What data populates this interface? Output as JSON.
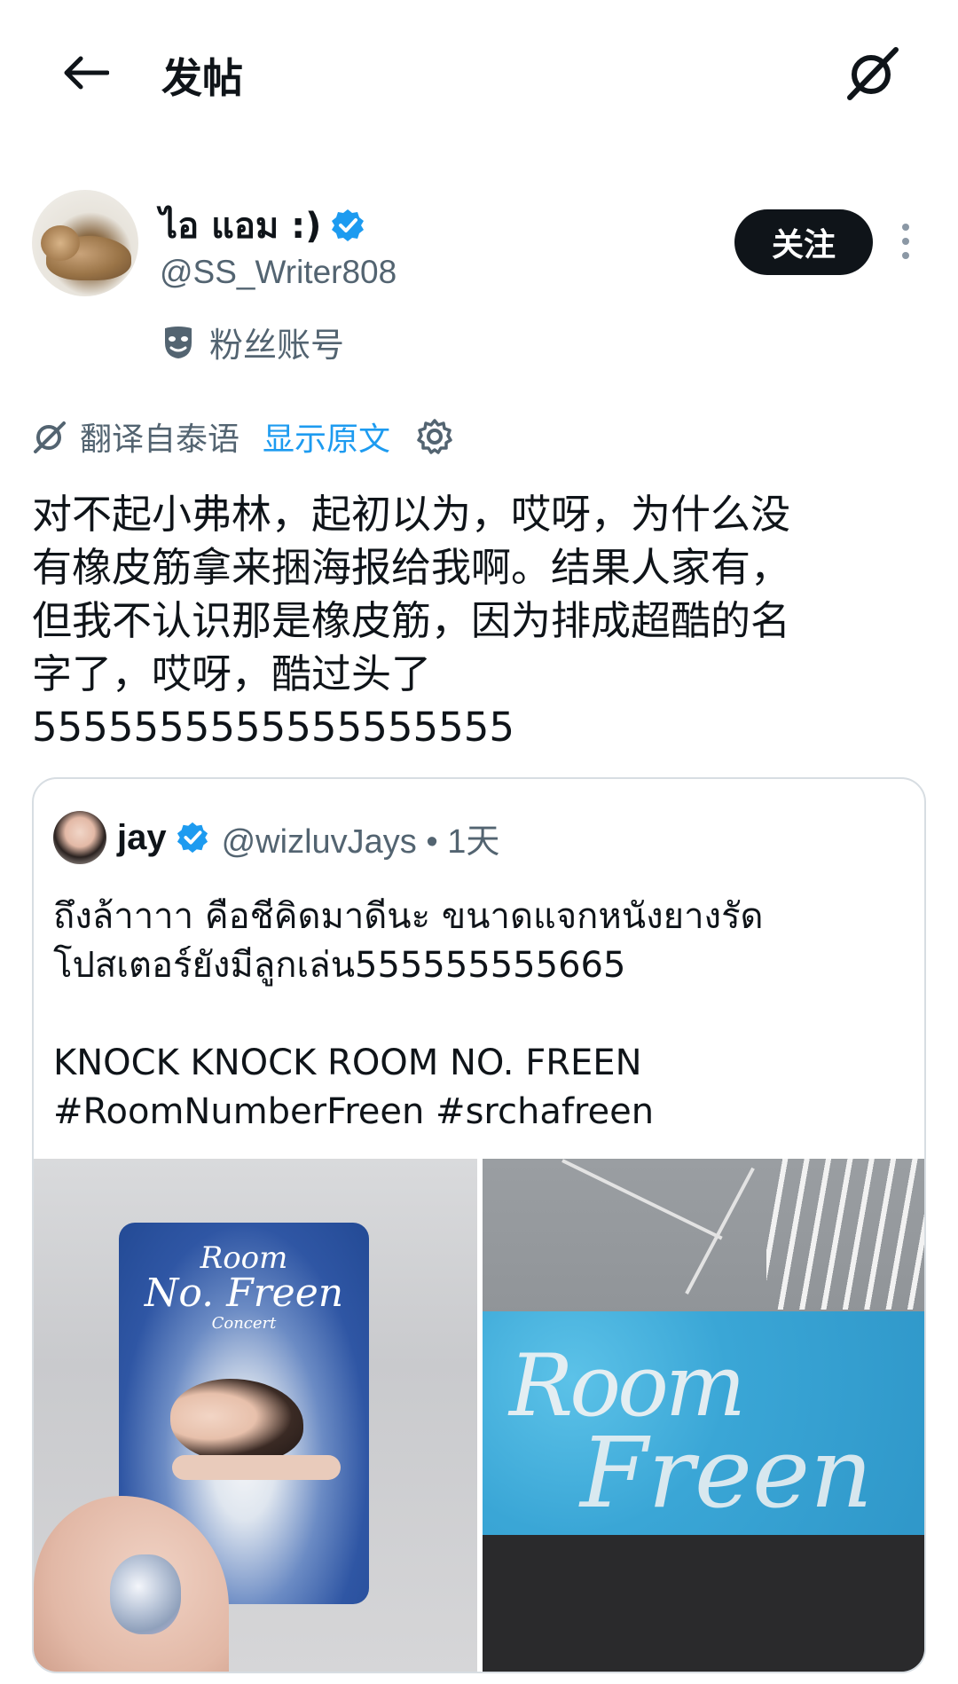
{
  "header": {
    "title": "发帖"
  },
  "author": {
    "name": "ไอ แอม :)",
    "handle": "@SS_Writer808",
    "badge_label": "粉丝账号",
    "follow_label": "关注"
  },
  "translation": {
    "label": "翻译自泰语",
    "show_original_label": "显示原文"
  },
  "post": {
    "text": "对不起小弗林，起初以为，哎呀，为什么没\n有橡皮筋拿来捆海报给我啊。结果人家有，\n但我不认识那是橡皮筋，因为排成超酷的名\n字了，哎呀，酷过头了\n5555555555555555555"
  },
  "quote": {
    "name": "jay",
    "handle_time": "@wizluvJays • 1天",
    "text": "ถึงล้าาาา คือชีคิดมาดีนะ ขนาดแจกหนังยางรัด\nโปสเตอร์ยังมีลูกเล่น555555555665\n\nKNOCK KNOCK ROOM NO. FREEN\n#RoomNumberFreen #srchafreen",
    "card_title_1": "Room",
    "card_title_2": "No. Freen",
    "card_title_3": "Concert",
    "flower_text": "Room",
    "flower_text_2": "Freen"
  },
  "colors": {
    "accent": "#1d9bf0",
    "text_primary": "#0f1419",
    "text_secondary": "#536471",
    "follow_bg": "#0f1419"
  },
  "icons": [
    "back-arrow-icon",
    "grok-icon",
    "verified-badge-icon",
    "mask-icon",
    "translate-icon",
    "gear-icon",
    "more-vertical-icon"
  ]
}
